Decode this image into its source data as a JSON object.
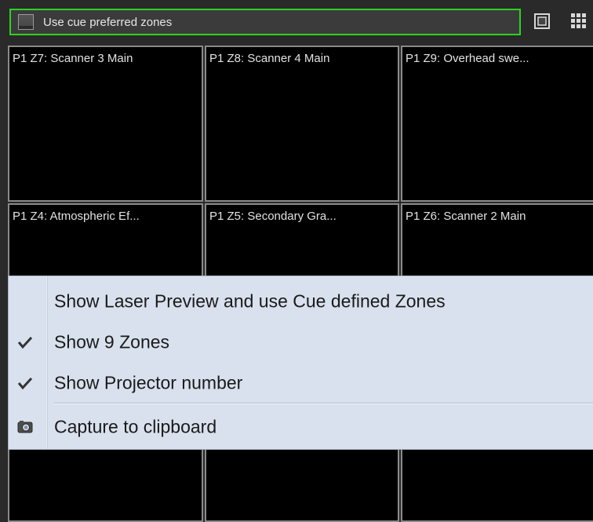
{
  "toolbar": {
    "use_cue_zones_label": "Use cue preferred zones",
    "use_cue_zones_checked": false,
    "icons": [
      "single-view-icon",
      "grid-view-icon"
    ],
    "accent_color": "#2ed21f"
  },
  "zones": {
    "top_row": [
      {
        "label": "P1 Z7: Scanner 3 Main"
      },
      {
        "label": "P1 Z8: Scanner 4 Main"
      },
      {
        "label": "P1 Z9: Overhead swe..."
      }
    ],
    "middle_row": [
      {
        "label": "P1 Z4: Atmospheric Ef..."
      },
      {
        "label": "P1 Z5: Secondary Gra..."
      },
      {
        "label": "P1 Z6: Scanner 2 Main"
      }
    ]
  },
  "context_menu": {
    "items": [
      {
        "label": "Show Laser Preview and use Cue defined Zones",
        "checked": false,
        "icon": ""
      },
      {
        "label": "Show 9 Zones",
        "checked": true,
        "icon": "checkmark-icon"
      },
      {
        "label": "Show Projector number",
        "checked": true,
        "icon": "checkmark-icon"
      },
      {
        "label": "Capture to clipboard",
        "checked": false,
        "icon": "camera-icon"
      }
    ]
  }
}
